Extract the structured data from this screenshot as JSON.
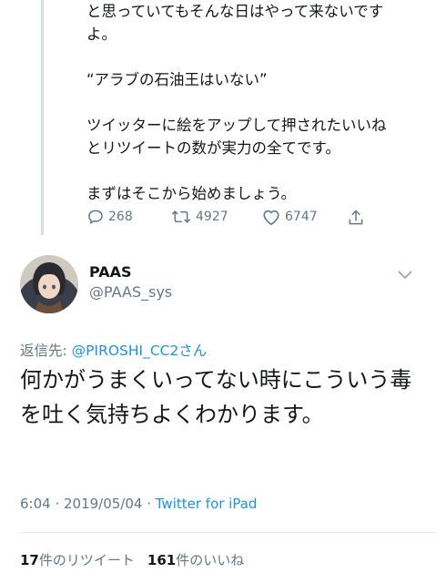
{
  "parent_tweet": {
    "lines": [
      "と思っていてもそんな日はやって来ないです\nよ。",
      "“アラブの石油王はいない”",
      "ツイッターに絵をアップして押されたいいね\nとリツイートの数が実力の全てです。",
      "まずはそこから始めましょう。"
    ],
    "reply_count": "268",
    "retweet_count": "4927",
    "like_count": "6747"
  },
  "tweet": {
    "display_name": "PAAS",
    "handle": "@PAAS_sys",
    "replying_label": "返信先: ",
    "replying_to": "@PIROSHI_CC2さん",
    "text": "何かがうまくいってない時にこういう毒を吐く気持ちよくわかります。",
    "time": "6:04 · 2019/05/04 · ",
    "source": "Twitter for iPad",
    "retweets": "17",
    "retweets_label": "件のリツイート",
    "likes": "161",
    "likes_label": "件のいいね"
  },
  "colors": {
    "link": "#1b95e0",
    "muted": "#657786",
    "thread_line": "#d6dde3"
  },
  "icons": [
    "reply-icon",
    "retweet-icon",
    "like-icon",
    "share-icon",
    "chevron-down-icon"
  ]
}
